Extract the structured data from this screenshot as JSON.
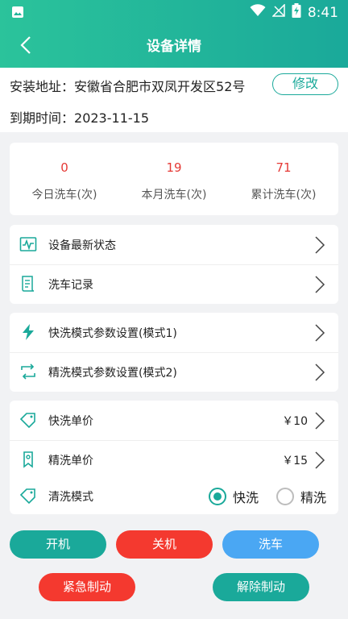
{
  "status_bar": {
    "time": "8:41"
  },
  "header": {
    "title": "设备详情"
  },
  "info": {
    "address_label": "安装地址：",
    "address_value": "安徽省合肥市双凤开发区52号",
    "edit_label": "修改",
    "expiry_label": "到期时间：",
    "expiry_value": "2023-11-15"
  },
  "stats": [
    {
      "value": "0",
      "label": "今日洗车(次)"
    },
    {
      "value": "19",
      "label": "本月洗车(次)"
    },
    {
      "value": "71",
      "label": "累计洗车(次)"
    }
  ],
  "menu1": [
    {
      "label": "设备最新状态",
      "icon": "pulse-icon"
    },
    {
      "label": "洗车记录",
      "icon": "document-icon"
    }
  ],
  "menu2": [
    {
      "label": "快洗模式参数设置(模式1)",
      "icon": "lightning-icon"
    },
    {
      "label": "精洗模式参数设置(模式2)",
      "icon": "cycle-icon"
    }
  ],
  "pricing": {
    "quick_label": "快洗单价",
    "quick_value": "￥10",
    "fine_label": "精洗单价",
    "fine_value": "￥15",
    "mode_label": "清洗模式",
    "mode_options": [
      "快洗",
      "精洗"
    ],
    "mode_selected": "快洗"
  },
  "buttons": {
    "power_on": "开机",
    "power_off": "关机",
    "wash": "洗车",
    "emergency_brake": "紧急制动",
    "release_brake": "解除制动"
  },
  "colors": {
    "accent": "#1aa99a",
    "danger": "#f4392f",
    "info": "#4aa7f3",
    "stat_number": "#e53935"
  }
}
